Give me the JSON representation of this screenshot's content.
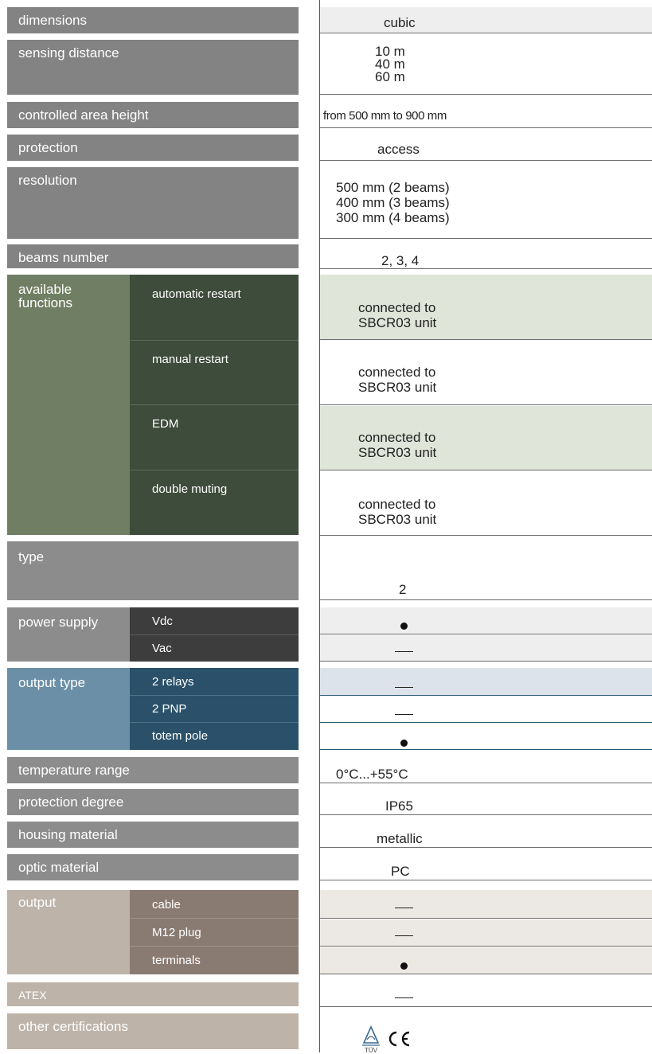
{
  "rows": {
    "dimensions": {
      "label": "dimensions",
      "value": "cubic"
    },
    "sensing_distance": {
      "label": "sensing distance",
      "value": "10 m\n40 m\n60 m"
    },
    "controlled_area_height": {
      "label": "controlled area height",
      "value": "from 500 mm to 900 mm"
    },
    "protection": {
      "label": "protection",
      "value": "access"
    },
    "resolution": {
      "label": "resolution",
      "value": "500 mm (2 beams)\n400 mm (3 beams)\n300 mm (4 beams)"
    },
    "beams_number": {
      "label": "beams number",
      "value": "2, 3, 4"
    },
    "available_functions": {
      "label": "available\nfunctions",
      "items": [
        {
          "label": "automatic restart",
          "value": "connected to\nSBCR03 unit"
        },
        {
          "label": "manual restart",
          "value": "connected to\nSBCR03 unit"
        },
        {
          "label": "EDM",
          "value": "connected to\nSBCR03 unit"
        },
        {
          "label": "double muting",
          "value": "connected to\nSBCR03 unit"
        }
      ]
    },
    "type": {
      "label": "type",
      "value": "2"
    },
    "power_supply": {
      "label": "power supply",
      "items": [
        {
          "label": "Vdc",
          "value": "dot"
        },
        {
          "label": "Vac",
          "value": "dash"
        }
      ]
    },
    "output_type": {
      "label": "output type",
      "items": [
        {
          "label": "2 relays",
          "value": "dash"
        },
        {
          "label": "2 PNP",
          "value": "dash"
        },
        {
          "label": "totem pole",
          "value": "dot"
        }
      ]
    },
    "temperature_range": {
      "label": "temperature range",
      "value": "0°C...+55°C"
    },
    "protection_degree": {
      "label": "protection degree",
      "value": "IP65"
    },
    "housing_material": {
      "label": "housing material",
      "value": "metallic"
    },
    "optic_material": {
      "label": "optic material",
      "value": "PC"
    },
    "output": {
      "label": "output",
      "items": [
        {
          "label": "cable",
          "value": "dash"
        },
        {
          "label": "M12 plug",
          "value": "dash"
        },
        {
          "label": "terminals",
          "value": "dot"
        }
      ]
    },
    "atex": {
      "label": "ATEX",
      "value": "dash"
    },
    "other_certifications": {
      "label": "other certifications",
      "logos": [
        "TÜV",
        "CE"
      ]
    }
  },
  "colors": {
    "gray_label": "#838383",
    "green_label": "#707f63",
    "green_dark": "#3e4c3b",
    "power_dark": "#3d3d3d",
    "blue_label": "#6b8fa6",
    "blue_dark": "#2a5169",
    "beige_label": "#bdb3a8",
    "beige_dark": "#8a7b72"
  }
}
